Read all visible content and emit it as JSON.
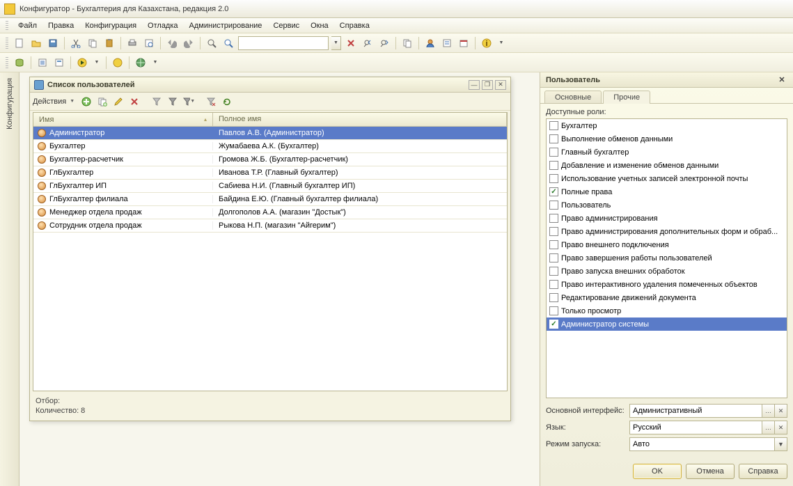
{
  "title": "Конфигуратор - Бухгалтерия для Казахстана, редакция 2.0",
  "menu": [
    "Файл",
    "Правка",
    "Конфигурация",
    "Отладка",
    "Администрирование",
    "Сервис",
    "Окна",
    "Справка"
  ],
  "config_tab": "Конфигурация",
  "user_list": {
    "title": "Список пользователей",
    "actions_label": "Действия",
    "col_name": "Имя",
    "col_full": "Полное имя",
    "rows": [
      {
        "name": "Администратор",
        "full": "Павлов А.В. (Администратор)"
      },
      {
        "name": "Бухгалтер",
        "full": "Жумабаева А.К. (Бухгалтер)"
      },
      {
        "name": "Бухгалтер-расчетчик",
        "full": "Громова Ж.Б. (Бухгалтер-расчетчик)"
      },
      {
        "name": "ГлБухгалтер",
        "full": "Иванова Т.Р. (Главный бухгалтер)"
      },
      {
        "name": "ГлБухгалтер ИП",
        "full": "Сабиева Н.И. (Главный бухгалтер ИП)"
      },
      {
        "name": "ГлБухгалтер филиала",
        "full": "Байдина Е.Ю. (Главный бухгалтер филиала)"
      },
      {
        "name": "Менеджер отдела продаж",
        "full": "Долгополов А.А. (магазин \"Достык\")"
      },
      {
        "name": "Сотрудник отдела продаж",
        "full": "Рыкова  Н.П. (магазин \"Айгерим\")"
      }
    ],
    "filter_label": "Отбор:",
    "count_label": "Количество: 8"
  },
  "right": {
    "title": "Пользователь",
    "tab_main": "Основные",
    "tab_other": "Прочие",
    "roles_label": "Доступные роли:",
    "roles": [
      {
        "label": "Бухгалтер",
        "checked": false
      },
      {
        "label": "Выполнение обменов данными",
        "checked": false
      },
      {
        "label": "Главный бухгалтер",
        "checked": false
      },
      {
        "label": "Добавление и изменение обменов данными",
        "checked": false
      },
      {
        "label": "Использование учетных записей электронной почты",
        "checked": false
      },
      {
        "label": "Полные права",
        "checked": true
      },
      {
        "label": "Пользователь",
        "checked": false
      },
      {
        "label": "Право администрирования",
        "checked": false
      },
      {
        "label": "Право администрирования дополнительных форм и обраб...",
        "checked": false
      },
      {
        "label": "Право внешнего подключения",
        "checked": false
      },
      {
        "label": "Право завершения работы пользователей",
        "checked": false
      },
      {
        "label": "Право запуска внешних обработок",
        "checked": false
      },
      {
        "label": "Право интерактивного удаления помеченных объектов",
        "checked": false
      },
      {
        "label": "Редактирование движений документа",
        "checked": false
      },
      {
        "label": "Только просмотр",
        "checked": false
      },
      {
        "label": "Администратор системы",
        "checked": true,
        "selected": true
      }
    ],
    "interface_label": "Основной интерфейс:",
    "interface_value": "Административный",
    "lang_label": "Язык:",
    "lang_value": "Русский",
    "launch_label": "Режим запуска:",
    "launch_value": "Авто",
    "btn_ok": "OK",
    "btn_cancel": "Отмена",
    "btn_help": "Справка"
  }
}
